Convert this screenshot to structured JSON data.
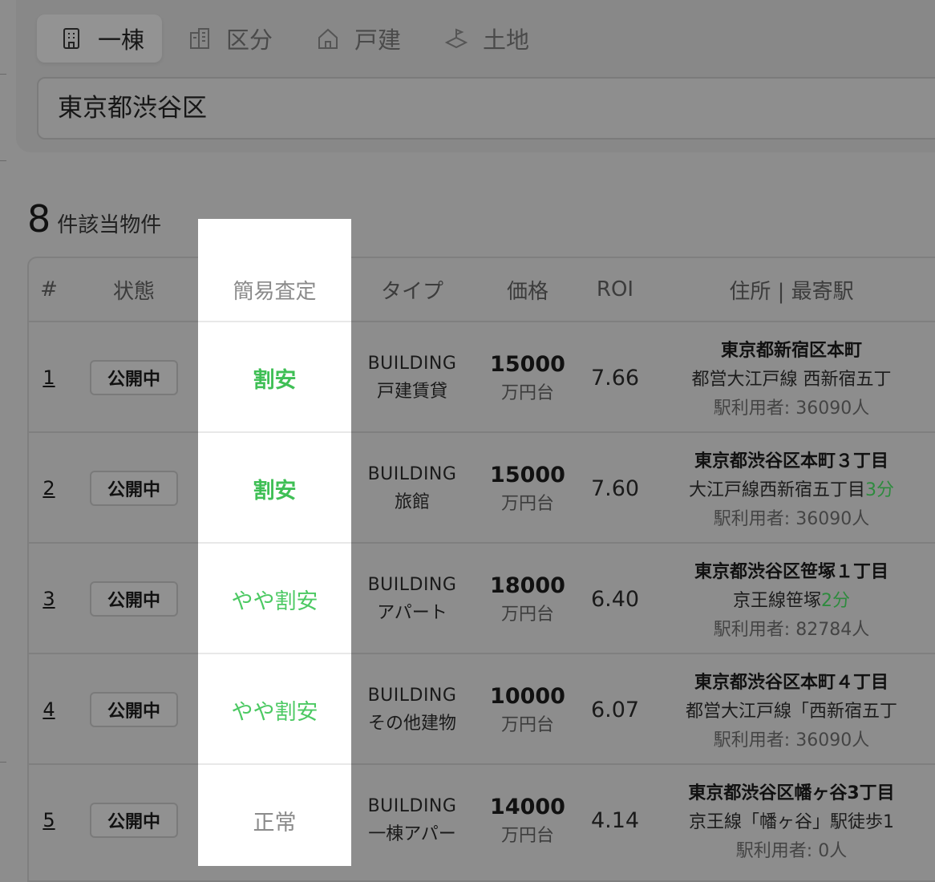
{
  "tabs": [
    {
      "label": "一棟",
      "icon": "building-icon",
      "active": true
    },
    {
      "label": "区分",
      "icon": "apartment-icon",
      "active": false
    },
    {
      "label": "戸建",
      "icon": "house-icon",
      "active": false
    },
    {
      "label": "土地",
      "icon": "land-icon",
      "active": false
    }
  ],
  "search": {
    "value": "東京都渋谷区"
  },
  "results": {
    "count": "8",
    "label": "件該当物件"
  },
  "table": {
    "headers": {
      "no": "#",
      "status": "状態",
      "assess": "簡易査定",
      "type": "タイプ",
      "price": "価格",
      "roi": "ROI",
      "address": "住所 | 最寄駅"
    },
    "rows": [
      {
        "no": "1",
        "status": "公開中",
        "assess": "割安",
        "assess_style": "bold",
        "type1": "BUILDING",
        "type2": "戸建賃貸",
        "price": "15000",
        "unit": "万円台",
        "roi": "7.66",
        "addr1": "東京都新宿区本町",
        "addr2": "都営大江戸線 西新宿五丁",
        "walk": "",
        "addr3": "駅利用者: 36090人"
      },
      {
        "no": "2",
        "status": "公開中",
        "assess": "割安",
        "assess_style": "bold",
        "type1": "BUILDING",
        "type2": "旅館",
        "price": "15000",
        "unit": "万円台",
        "roi": "7.60",
        "addr1": "東京都渋谷区本町３丁目",
        "addr2": "大江戸線西新宿五丁目",
        "walk": "3分",
        "addr3": "駅利用者: 36090人"
      },
      {
        "no": "3",
        "status": "公開中",
        "assess": "やや割安",
        "assess_style": "light",
        "type1": "BUILDING",
        "type2": "アパート",
        "price": "18000",
        "unit": "万円台",
        "roi": "6.40",
        "addr1": "東京都渋谷区笹塚１丁目",
        "addr2": "京王線笹塚",
        "walk": "2分",
        "addr3": "駅利用者: 82784人"
      },
      {
        "no": "4",
        "status": "公開中",
        "assess": "やや割安",
        "assess_style": "light",
        "type1": "BUILDING",
        "type2": "その他建物",
        "price": "10000",
        "unit": "万円台",
        "roi": "6.07",
        "addr1": "東京都渋谷区本町４丁目",
        "addr2": "都営大江戸線「西新宿五丁",
        "walk": "",
        "addr3": "駅利用者: 36090人"
      },
      {
        "no": "5",
        "status": "公開中",
        "assess": "正常",
        "assess_style": "normal",
        "type1": "BUILDING",
        "type2": "一棟アパー",
        "price": "14000",
        "unit": "万円台",
        "roi": "4.14",
        "addr1": "東京都渋谷区幡ヶ谷3丁目",
        "addr2": "京王線「幡ヶ谷」駅徒歩1",
        "walk": "",
        "addr3": "駅利用者: 0人"
      }
    ]
  },
  "colors": {
    "green": "#3fbf55",
    "highlight": "#ffffff",
    "overlay": "#8d8d8d"
  }
}
